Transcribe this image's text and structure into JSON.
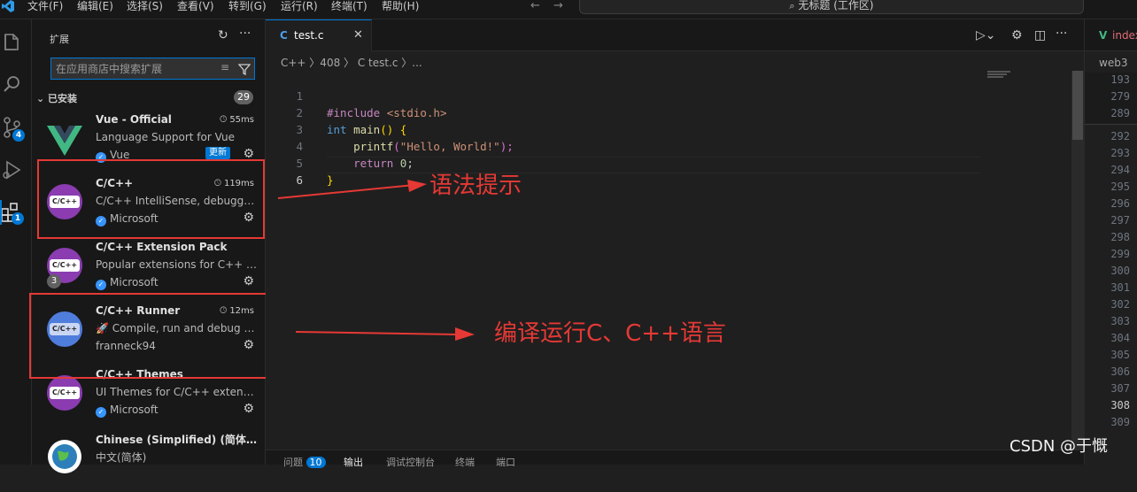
{
  "titlebar": {
    "menus": [
      "文件(F)",
      "编辑(E)",
      "选择(S)",
      "查看(V)",
      "转到(G)",
      "运行(R)",
      "终端(T)",
      "帮助(H)"
    ],
    "search_label": "无标题 (工作区)"
  },
  "activity": {
    "source_control_badge": "4",
    "extensions_badge": "1"
  },
  "sidebar": {
    "title": "扩展",
    "search_placeholder": "在应用商店中搜索扩展",
    "section_title": "已安装",
    "installed_count": "29",
    "extensions": [
      {
        "name": "Vue - Official",
        "desc": "Language Support for Vue",
        "publisher": "Vue",
        "time": "55ms",
        "update_label": "更新"
      },
      {
        "name": "C/C++",
        "desc": "C/C++ IntelliSense, debugging, and code browsing.",
        "publisher": "Microsoft",
        "time": "119ms",
        "logo": "C/C++"
      },
      {
        "name": "C/C++ Extension Pack",
        "desc": "Popular extensions for C++ development in VS Code.",
        "publisher": "Microsoft",
        "logo": "C/C++",
        "count": "3"
      },
      {
        "name": "C/C++ Runner",
        "desc": "🚀 Compile, run and debug single or multiple C/C++ files with ease.",
        "publisher": "franneck94",
        "time": "12ms",
        "logo": "C/C++"
      },
      {
        "name": "C/C++ Themes",
        "desc": "UI Themes for C/C++ extension.",
        "publisher": "Microsoft",
        "logo": "C/C++"
      },
      {
        "name": "Chinese (Simplified) (简体中文) Language Pack",
        "desc": "中文(简体)"
      }
    ]
  },
  "editor": {
    "tab_label": "test.c",
    "tab_icon_letter": "C",
    "breadcrumb": "C++ 〉408 〉 C  test.c 〉...",
    "line_numbers": [
      "1",
      "2",
      "3",
      "4",
      "5",
      "6"
    ],
    "code": {
      "l1_directive": "#include",
      "l1_header": " <stdio.h>",
      "l2_kw": "int",
      "l2_fn": " main",
      "l2_paren": "()",
      "l2_brace": " {",
      "l3_fn": "printf",
      "l3_open": "(",
      "l3_str": "\"Hello, World!\"",
      "l3_close": ");",
      "l4_kw": "return",
      "l4_num": " 0",
      "l4_semi": ";",
      "l5_brace": "}"
    },
    "annotations": {
      "syntax": "语法提示",
      "compile": "编译运行C、C++语言"
    },
    "panel_tabs": [
      "问题",
      "输出",
      "调试控制台",
      "终端",
      "端口"
    ],
    "problems_count": "10"
  },
  "right_editor": {
    "tab_label": "index",
    "breadcrumb": "web3",
    "line_numbers": [
      "193",
      "279",
      "289",
      "292",
      "293",
      "294",
      "295",
      "296",
      "297",
      "298",
      "299",
      "300",
      "301",
      "302",
      "303",
      "304",
      "305",
      "306",
      "307",
      "308",
      "309"
    ]
  },
  "watermark": "CSDN @于慨"
}
